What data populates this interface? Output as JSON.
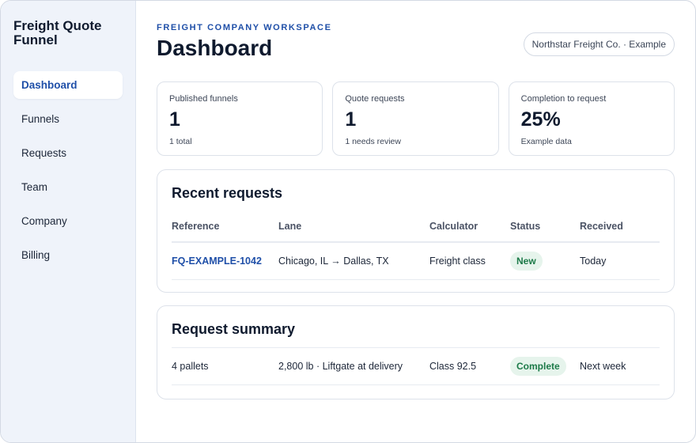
{
  "app": {
    "title": "Freight Quote Funnel"
  },
  "nav": {
    "items": [
      {
        "label": "Dashboard",
        "active": true
      },
      {
        "label": "Funnels"
      },
      {
        "label": "Requests"
      },
      {
        "label": "Team"
      },
      {
        "label": "Company"
      },
      {
        "label": "Billing"
      }
    ]
  },
  "header": {
    "eyebrow": "FREIGHT COMPANY WORKSPACE",
    "title": "Dashboard",
    "company": "Northstar Freight Co. · Example"
  },
  "stats": [
    {
      "label": "Published funnels",
      "value": "1",
      "sub": "1 total"
    },
    {
      "label": "Quote requests",
      "value": "1",
      "sub": "1 needs review"
    },
    {
      "label": "Completion to request",
      "value": "25%",
      "sub": "Example data"
    }
  ],
  "recent": {
    "title": "Recent requests",
    "columns": [
      "Reference",
      "Lane",
      "Calculator",
      "Status",
      "Received"
    ],
    "rows": [
      {
        "reference": "FQ-EXAMPLE-1042",
        "lane": "Chicago, IL → Dallas, TX",
        "calculator": "Freight class",
        "status": "New",
        "received": "Today"
      }
    ]
  },
  "summary": {
    "title": "Request summary",
    "row": {
      "pallets": "4 pallets",
      "weight": "2,800 lb · Liftgate at delivery",
      "class": "Class 92.5",
      "status": "Complete",
      "when": "Next week"
    }
  },
  "colors": {
    "accent": "#1f4fa8",
    "success": "#1c7a48",
    "success_bg": "#e6f4ec",
    "sidebar_bg": "#eff3fa"
  }
}
